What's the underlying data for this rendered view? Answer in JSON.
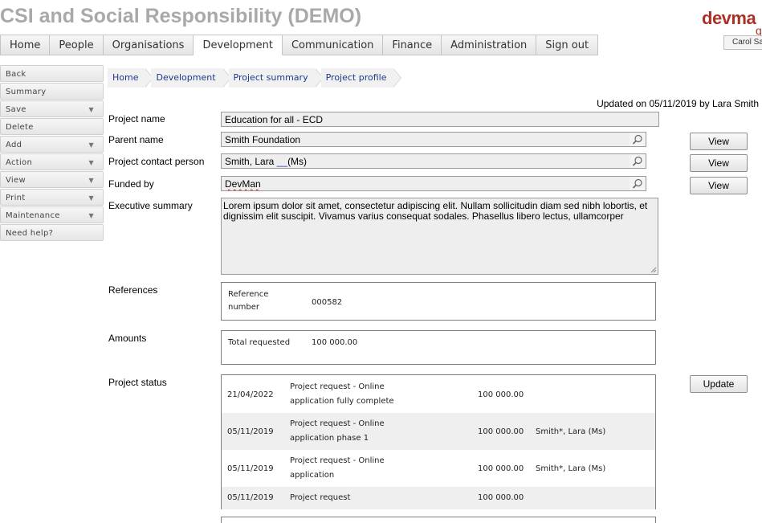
{
  "app": {
    "title": "CSI and Social Responsibility (DEMO)",
    "logo": "devma",
    "logo_tail": "g",
    "user": "Carol Sau"
  },
  "menu": [
    "Home",
    "People",
    "Organisations",
    "Development",
    "Communication",
    "Finance",
    "Administration",
    "Sign out"
  ],
  "sidebar": [
    {
      "label": "Back",
      "caret": ""
    },
    {
      "label": "Summary",
      "caret": ""
    },
    {
      "label": "Save",
      "caret": "▼"
    },
    {
      "label": "Delete",
      "caret": ""
    },
    {
      "label": "Add",
      "caret": "▼"
    },
    {
      "label": "Action",
      "caret": "▼"
    },
    {
      "label": "View",
      "caret": "▼"
    },
    {
      "label": "Print",
      "caret": "▼"
    },
    {
      "label": "Maintenance",
      "caret": "▼"
    },
    {
      "label": "Need help?",
      "caret": ""
    }
  ],
  "breadcrumb": [
    "Home",
    "Development",
    "Project summary",
    "Project profile"
  ],
  "updated": "Updated on 05/11/2019 by Lara Smith",
  "form": {
    "project_name_label": "Project name",
    "project_name": "Education for all - ECD",
    "parent_name_label": "Parent name",
    "parent_name": "Smith Foundation",
    "contact_label": "Project contact person",
    "contact_name": "Smith, Lara ",
    "contact_title": "(Ms)",
    "funded_label": "Funded by",
    "funded_by": "DevMan",
    "exec_label": "Executive summary",
    "exec_line1": "Lorem ipsum dolor sit amet, consectetur adipiscing elit. Nullam sollicitudin diam sed nibh lobortis, et",
    "exec_line2": "dignissim elit suscipit. Vivamus varius consequat sodales. Phasellus libero lectus, ullamcorper",
    "view_label": "View",
    "update_label": "Update"
  },
  "references": {
    "label": "References",
    "ref_label_1": "Reference",
    "ref_label_2": "number",
    "ref_value": "000582"
  },
  "amounts": {
    "label": "Amounts",
    "total_label": "Total requested",
    "total_value": "100 000.00"
  },
  "status": {
    "label": "Project status",
    "rows": [
      {
        "date": "21/04/2022",
        "desc1": "Project request - Online",
        "desc2": "application fully complete",
        "amount": "100 000.00",
        "person": ""
      },
      {
        "date": "05/11/2019",
        "desc1": "Project request - Online",
        "desc2": "application phase 1",
        "amount": "100 000.00",
        "person": "Smith*, Lara (Ms)"
      },
      {
        "date": "05/11/2019",
        "desc1": "Project request - Online",
        "desc2": "application",
        "amount": "100 000.00",
        "person": "Smith*, Lara (Ms)"
      },
      {
        "date": "05/11/2019",
        "desc1": "Project request",
        "desc2": "",
        "amount": "100 000.00",
        "person": ""
      }
    ]
  }
}
